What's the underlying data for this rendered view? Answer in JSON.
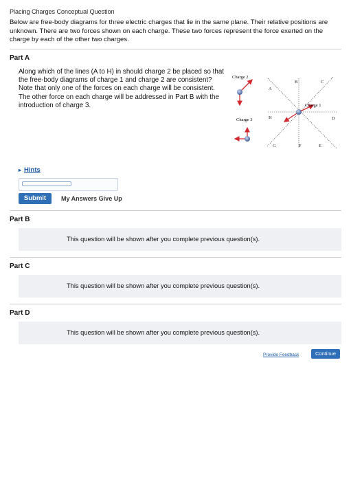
{
  "page": {
    "title": "Placing Charges Conceptual Question",
    "intro": "Below are free-body diagrams for three electric charges that lie in the same plane. Their relative positions are unknown. There are two forces shown on each charge. These two forces represent the force exerted on the charge by each of the other two charges."
  },
  "partA": {
    "label": "Part A",
    "question": "Along which of the lines (A to H) in should charge 2 be placed so that the free-body diagrams of charge 1 and charge 2 are consistent? Note that only one of the forces on each charge will be consistent. The other force on each charge will be addressed in Part B with the introduction of charge 3.",
    "hints": "Hints",
    "submit": "Submit",
    "my_answers": "My Answers Give Up"
  },
  "diagram": {
    "charge1": "Charge 1",
    "charge2": "Charge 2",
    "charge3": "Charge 3",
    "lines": [
      "A",
      "B",
      "C",
      "D",
      "E",
      "F",
      "G",
      "H"
    ],
    "colors": {
      "charge": "#5b78a8",
      "arrow": "#d0282e",
      "dashed": "#333333"
    }
  },
  "partB": {
    "label": "Part B",
    "message": "This question will be shown after you complete previous question(s)."
  },
  "partC": {
    "label": "Part C",
    "message": "This question will be shown after you complete previous question(s)."
  },
  "partD": {
    "label": "Part D",
    "message": "This question will be shown after you complete previous question(s)."
  },
  "footer": {
    "feedback": "Provide Feedback",
    "continue": "Continue"
  }
}
